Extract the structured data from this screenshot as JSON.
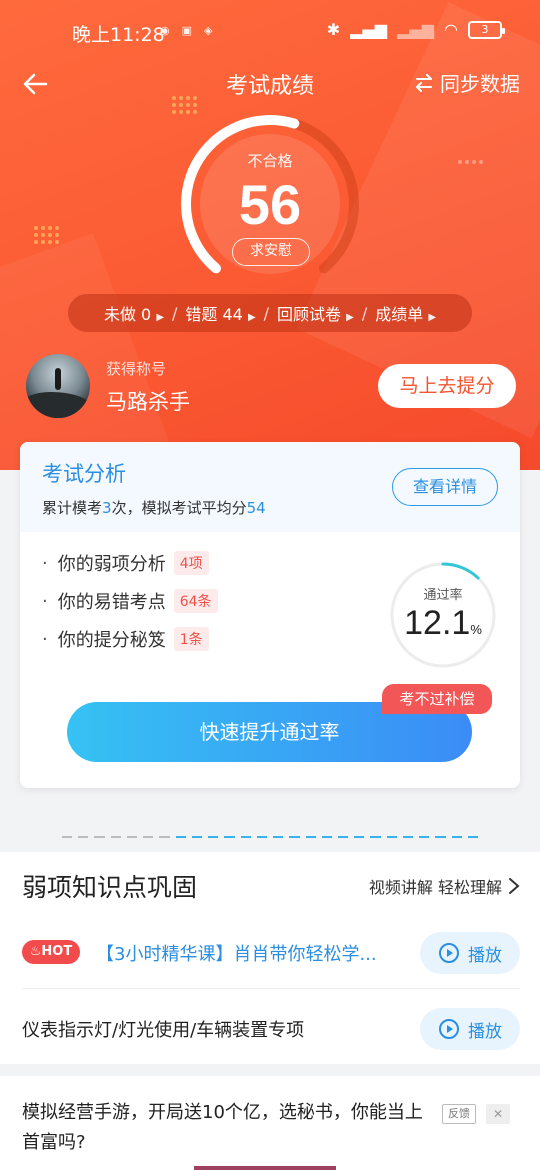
{
  "status_bar": {
    "time": "晚上11:28",
    "battery": "3"
  },
  "nav": {
    "title": "考试成绩",
    "sync_label": "同步数据"
  },
  "score": {
    "status": "不合格",
    "value": "56",
    "button": "求安慰",
    "fraction": 0.56
  },
  "stats": [
    {
      "label": "未做 0"
    },
    {
      "label": "错题  44"
    },
    {
      "label": "回顾试卷"
    },
    {
      "label": "成绩单"
    }
  ],
  "user": {
    "title_label": "获得称号",
    "title": "马路杀手",
    "button": "马上去提分"
  },
  "analysis": {
    "title": "考试分析",
    "summary_prefix": "累计模考",
    "mock_count": "3",
    "summary_mid": "次，模拟考试平均分",
    "avg_score": "54",
    "detail_button": "查看详情",
    "items": [
      {
        "label": "你的弱项分析",
        "tag": "4项"
      },
      {
        "label": "你的易错考点",
        "tag": "64条"
      },
      {
        "label": "你的提分秘笈",
        "tag": "1条"
      }
    ],
    "pass_rate_label": "通过率",
    "pass_rate": "12.1",
    "pass_rate_unit": "%",
    "pass_rate_fraction": 0.121,
    "badge": "考不过补偿",
    "main_button": "快速提升通过率"
  },
  "weak_section": {
    "title": "弱项知识点巩固",
    "right_text": "视频讲解 轻松理解",
    "hot_label": "HOT",
    "videos": [
      {
        "text": "【3小时精华课】肖肖带你轻松学...",
        "play": "播放"
      },
      {
        "text": "仪表指示灯/灯光使用/车辆装置专项",
        "play": "播放"
      }
    ]
  },
  "ad": {
    "text": "模拟经营手游，开局送10个亿，选秘书，你能当上首富吗?",
    "feedback": "反馈",
    "close": "✕"
  },
  "colors": {
    "hero": "#fb5a33",
    "accent_blue": "#2b8ee0",
    "danger": "#f24b4b"
  }
}
